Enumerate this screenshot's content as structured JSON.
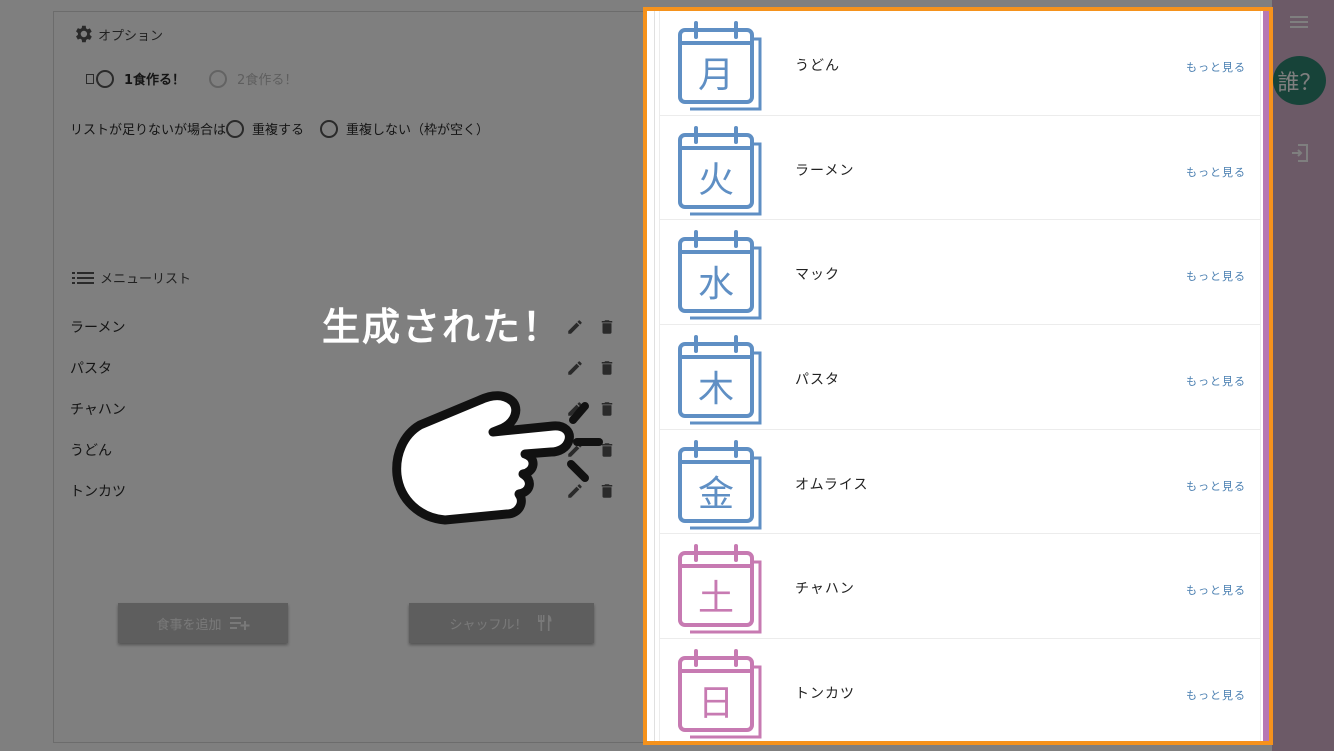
{
  "options": {
    "title": "オプション",
    "meal_one": "1食作る！",
    "meal_two": "2食作る！",
    "shortage_label": "リストが足りないが場合は",
    "duplicate": "重複する",
    "no_duplicate": "重複しない（枠が空く）"
  },
  "menu": {
    "title": "メニューリスト",
    "items": [
      "ラーメン",
      "パスタ",
      "チャハン",
      "うどん",
      "トンカツ"
    ]
  },
  "buttons": {
    "add_meal": "食事を追加",
    "shuffle": "シャッフル！"
  },
  "rail": {
    "avatar_text": "誰？"
  },
  "annotation": {
    "text": "生成された！"
  },
  "week": [
    {
      "day": "月",
      "dish": "うどん",
      "more": "もっと見る",
      "color": "#5f8fc4"
    },
    {
      "day": "火",
      "dish": "ラーメン",
      "more": "もっと見る",
      "color": "#5f8fc4"
    },
    {
      "day": "水",
      "dish": "マック",
      "more": "もっと見る",
      "color": "#5f8fc4"
    },
    {
      "day": "木",
      "dish": "パスタ",
      "more": "もっと見る",
      "color": "#5f8fc4"
    },
    {
      "day": "金",
      "dish": "オムライス",
      "more": "もっと見る",
      "color": "#5f8fc4"
    },
    {
      "day": "土",
      "dish": "チャハン",
      "more": "もっと見る",
      "color": "#c77ab2"
    },
    {
      "day": "日",
      "dish": "トンカツ",
      "more": "もっと見る",
      "color": "#c77ab2"
    }
  ],
  "colors": {
    "highlight": "#f5921c",
    "weekday": "#5f8fc4",
    "weekend": "#c77ab2",
    "link": "#4a7fb1",
    "avatar": "#2f8673"
  }
}
